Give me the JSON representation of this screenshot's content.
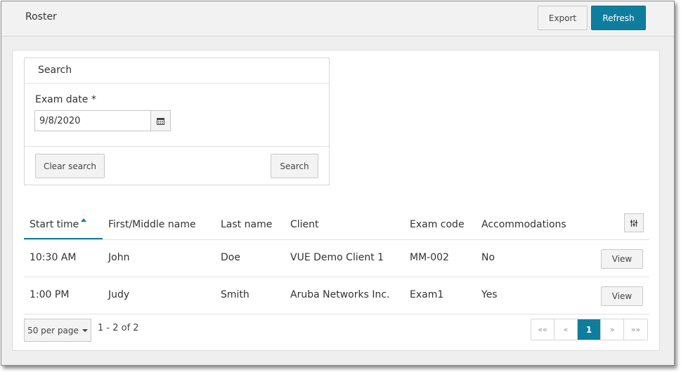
{
  "header": {
    "title": "Roster",
    "export_label": "Export",
    "refresh_label": "Refresh"
  },
  "search": {
    "title": "Search",
    "date_label": "Exam date *",
    "date_value": "9/8/2020",
    "clear_label": "Clear search",
    "search_label": "Search"
  },
  "table": {
    "columns": [
      "Start time",
      "First/Middle name",
      "Last name",
      "Client",
      "Exam code",
      "Accommodations"
    ],
    "sorted_column": "Start time",
    "rows": [
      {
        "start": "10:30 AM",
        "first": "John",
        "last": "Doe",
        "client": "VUE Demo Client 1",
        "code": "MM-002",
        "acc": "No",
        "action": "View"
      },
      {
        "start": "1:00 PM",
        "first": "Judy",
        "last": "Smith",
        "client": "Aruba Networks Inc.",
        "code": "Exam1",
        "acc": "Yes",
        "action": "View"
      }
    ]
  },
  "footer": {
    "per_page": "50 per page",
    "range": "1 - 2 of 2",
    "pager": {
      "first": "««",
      "prev": "«",
      "current": "1",
      "next": "»",
      "last": "»»"
    }
  },
  "colors": {
    "accent": "#0f7e9e",
    "background": "#efefef"
  },
  "icons": {
    "calendar": "calendar-icon",
    "columns": "column-settings-icon",
    "sort": "sort-ascending-icon"
  }
}
